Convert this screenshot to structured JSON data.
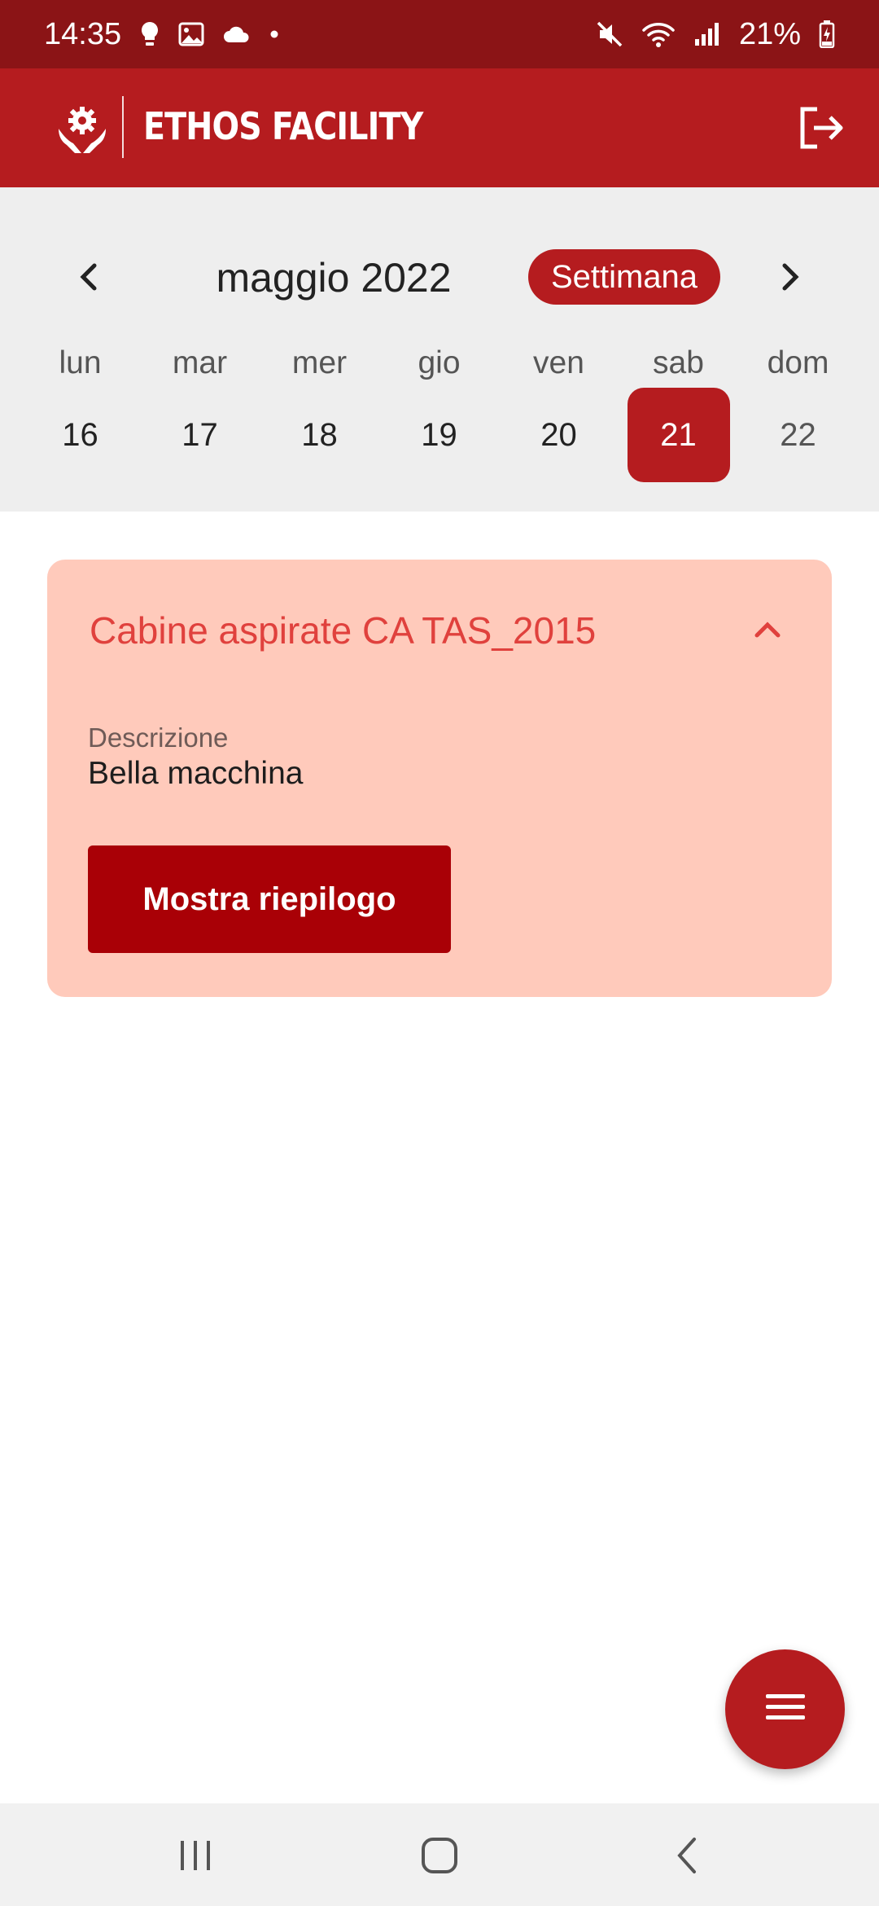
{
  "status_bar": {
    "time": "14:35",
    "battery": "21%",
    "left_icons": [
      "bulb-icon",
      "image-icon",
      "cloud-icon",
      "dot-icon"
    ],
    "right_icons": [
      "mute-icon",
      "wifi-icon",
      "signal-icon",
      "battery-icon"
    ]
  },
  "app_bar": {
    "title": "ETHOS FACILITY",
    "logo_icon": "hands-gear-icon",
    "logout_icon": "logout-icon"
  },
  "calendar": {
    "month": "maggio 2022",
    "view_label": "Settimana",
    "weekdays": [
      "lun",
      "mar",
      "mer",
      "gio",
      "ven",
      "sab",
      "dom"
    ],
    "days": [
      "16",
      "17",
      "18",
      "19",
      "20",
      "21",
      "22"
    ],
    "selected_day": "21"
  },
  "card": {
    "title": "Cabine aspirate CA TAS_2015",
    "description_label": "Descrizione",
    "description_value": "Bella macchina",
    "button_label": "Mostra riepilogo"
  },
  "colors": {
    "status_bar": "#8b1416",
    "primary": "#b51c1f",
    "button": "#a90006",
    "card_background": "#ffcabb",
    "card_title": "#e0413d"
  },
  "fab_icon": "menu-icon",
  "system_nav": [
    "recent-apps-icon",
    "home-icon",
    "back-icon"
  ]
}
